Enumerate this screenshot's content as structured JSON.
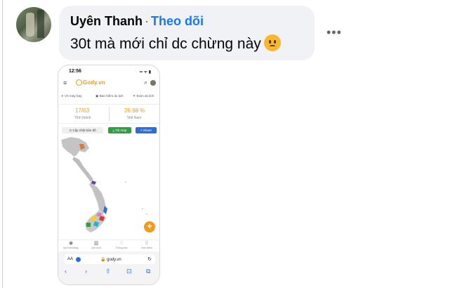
{
  "comment": {
    "author": "Uyên Thanh",
    "separator": "·",
    "follow_label": "Theo dõi",
    "text": "30t mà mới chỉ dc chừng này",
    "emoji": "frowning-face",
    "more_label": "•••"
  },
  "phone": {
    "status_time": "12:56",
    "status_icons": "▪▪ ᯤ ▮",
    "header": {
      "menu": "≡",
      "logo": "Gody.vn",
      "search": "⌕"
    },
    "tabs": [
      "✈ Vé máy bay",
      "▣ Bảo hiểm du lịch",
      "ᯤ Esim du lịch"
    ],
    "stats": [
      {
        "value": "17/63",
        "label": "Tỉnh thành"
      },
      {
        "value": "26.98 %",
        "label": "Việt Nam"
      }
    ],
    "buttons": {
      "update": "⊙ Cập nhật bản đồ",
      "download": "⤓ Tải map",
      "share": "< Share"
    },
    "fab": "+",
    "bottom_nav": [
      {
        "icon": "◉",
        "label": "MyTravelMap"
      },
      {
        "icon": "▥",
        "label": "Lịch trình"
      },
      {
        "icon": "♢",
        "label": "Thông báo"
      },
      {
        "icon": "⁞⁞",
        "label": "Xem thêm"
      }
    ],
    "safari": {
      "aa": "AA",
      "url": "🔒 gody.vn",
      "reload": "↻",
      "toolbar": [
        "‹",
        "›",
        "⇧",
        "⊡",
        "⧉"
      ]
    }
  },
  "colors": {
    "accent": "#1877f2",
    "brand": "#f29b1c",
    "bubble": "#f0f2f5"
  }
}
